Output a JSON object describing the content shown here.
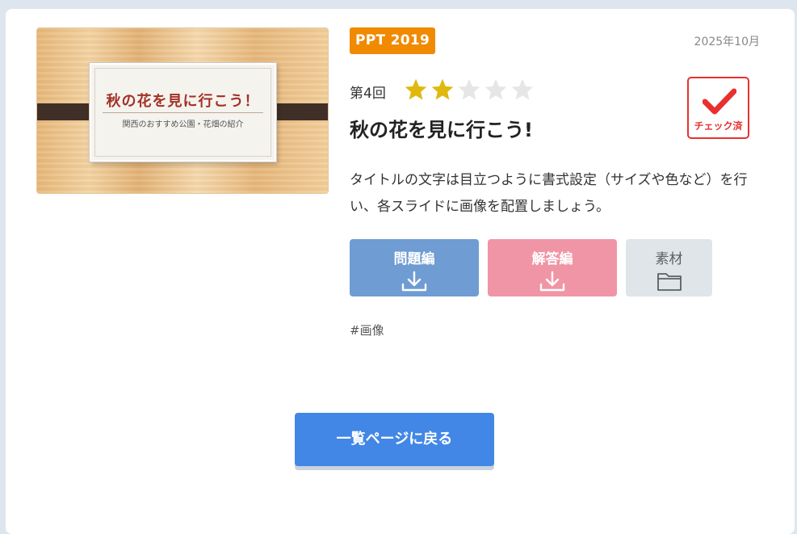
{
  "thumbnail": {
    "title": "秋の花を見に行こう！",
    "subtitle": "関西のおすすめ公園・花畑の紹介"
  },
  "header": {
    "version_badge": "PPT 2019",
    "date": "2025年10月"
  },
  "lesson": {
    "round": "第4回",
    "difficulty": {
      "filled": 2,
      "total": 5,
      "filled_color": "#e0b90f",
      "empty_color": "#e6e6e6"
    },
    "title": "秋の花を見に行こう!",
    "check_label": "チェック済",
    "description": "タイトルの文字は目立つように書式設定（サイズや色など）を行い、各スライドに画像を配置しましょう。"
  },
  "buttons": {
    "problem": {
      "label": "問題編",
      "icon": "download-icon"
    },
    "answer": {
      "label": "解答編",
      "icon": "download-icon"
    },
    "material": {
      "label": "素材",
      "icon": "folder-icon"
    }
  },
  "tags": [
    "#画像"
  ],
  "back_button": {
    "label": "一覧ページに戻る"
  },
  "colors": {
    "badge": "#f08a00",
    "problem_button": "#6f9cd2",
    "answer_button": "#f095a5",
    "material_button": "#dfe5e8",
    "back_button": "#4287e5",
    "check": "#e8302f"
  }
}
